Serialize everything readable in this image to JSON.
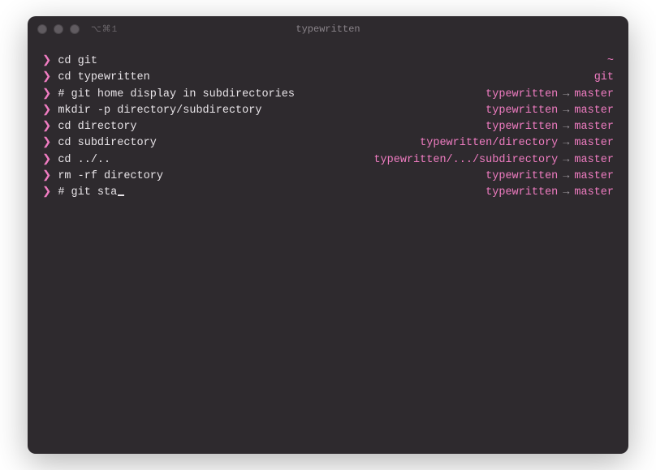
{
  "window": {
    "title": "typewritten",
    "shell_indicator": "⌥⌘1"
  },
  "prompt_symbol": "❯",
  "arrow": "→",
  "lines": [
    {
      "command": "cd git",
      "right_kind": "home",
      "home": "~"
    },
    {
      "command": "cd typewritten",
      "right_kind": "path_only",
      "path": "git"
    },
    {
      "command": "# git home display in subdirectories",
      "right_kind": "git",
      "path": "typewritten",
      "branch": "master"
    },
    {
      "command": "mkdir -p directory/subdirectory",
      "right_kind": "git",
      "path": "typewritten",
      "branch": "master"
    },
    {
      "command": "cd directory",
      "right_kind": "git",
      "path": "typewritten",
      "branch": "master"
    },
    {
      "command": "cd subdirectory",
      "right_kind": "git",
      "path": "typewritten/directory",
      "branch": "master"
    },
    {
      "command": "cd ../..",
      "right_kind": "git",
      "path": "typewritten/.../subdirectory",
      "branch": "master"
    },
    {
      "command": "rm -rf directory",
      "right_kind": "git",
      "path": "typewritten",
      "branch": "master"
    },
    {
      "command": "# git sta",
      "right_kind": "git",
      "path": "typewritten",
      "branch": "master",
      "cursor": true
    }
  ]
}
